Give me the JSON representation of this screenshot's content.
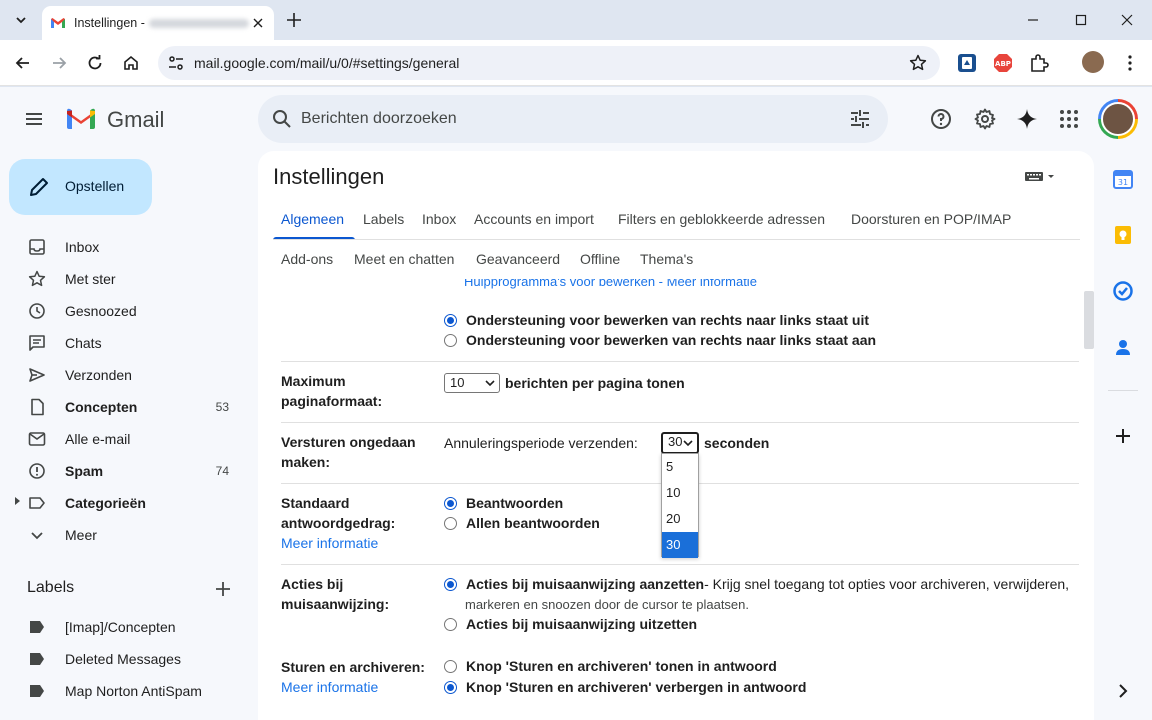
{
  "browser": {
    "tab_title": "Instellingen -",
    "url": "mail.google.com/mail/u/0/#settings/general"
  },
  "gmail": {
    "brand": "Gmail",
    "search_placeholder": "Berichten doorzoeken",
    "compose_label": "Opstellen",
    "nav": [
      {
        "label": "Inbox",
        "icon": "inbox-icon",
        "count": ""
      },
      {
        "label": "Met ster",
        "icon": "star-icon",
        "count": ""
      },
      {
        "label": "Gesnoozed",
        "icon": "clock-icon",
        "count": ""
      },
      {
        "label": "Chats",
        "icon": "chat-icon",
        "count": ""
      },
      {
        "label": "Verzonden",
        "icon": "send-icon",
        "count": ""
      },
      {
        "label": "Concepten",
        "icon": "draft-icon",
        "count": "53"
      },
      {
        "label": "Alle e-mail",
        "icon": "all-mail-icon",
        "count": ""
      },
      {
        "label": "Spam",
        "icon": "spam-icon",
        "count": "74"
      },
      {
        "label": "Categorieën",
        "icon": "label-outline-icon",
        "count": ""
      },
      {
        "label": "Meer",
        "icon": "chevron-down-icon",
        "count": ""
      }
    ],
    "labels_title": "Labels",
    "labels": [
      "[Imap]/Concepten",
      "Deleted Messages",
      "Map Norton AntiSpam"
    ]
  },
  "settings": {
    "title": "Instellingen",
    "tabs_row1": [
      "Algemeen",
      "Labels",
      "Inbox",
      "Accounts en import",
      "Filters en geblokkeerde adressen",
      "Doorsturen en POP/IMAP"
    ],
    "tabs_row2": [
      "Add-ons",
      "Meet en chatten",
      "Geavanceerd",
      "Offline",
      "Thema's"
    ],
    "partial_link": "Hulpprogramma's voor bewerken - Meer informatie",
    "rtl": {
      "off": "Ondersteuning voor bewerken van rechts naar links staat uit",
      "on": "Ondersteuning voor bewerken van rechts naar links staat aan"
    },
    "page_size": {
      "label_line1": "Maximum",
      "label_line2": "paginaformaat:",
      "value": "10",
      "suffix": "berichten per pagina tonen"
    },
    "undo_send": {
      "label_line1": "Versturen ongedaan",
      "label_line2": "maken:",
      "prefix": "Annuleringsperiode verzenden:",
      "value": "30",
      "suffix": "seconden",
      "options": [
        "5",
        "10",
        "20",
        "30"
      ]
    },
    "reply": {
      "label_line1": "Standaard",
      "label_line2": "antwoordgedrag:",
      "link": "Meer informatie",
      "opt1": "Beantwoorden",
      "opt2": "Allen beantwoorden"
    },
    "hover": {
      "label_line1": "Acties bij",
      "label_line2": "muisaanwijzing:",
      "opt1": "Acties bij muisaanwijzing aanzetten",
      "opt1_desc": " - Krijg snel toegang tot opties voor archiveren, verwijderen,",
      "opt1_desc2": "markeren en snoozen door de cursor te plaatsen.",
      "opt2": "Acties bij muisaanwijzing uitzetten"
    },
    "send_archive": {
      "label": "Sturen en archiveren:",
      "link": "Meer informatie",
      "opt1": "Knop 'Sturen en archiveren' tonen in antwoord",
      "opt2": "Knop 'Sturen en archiveren' verbergen in antwoord"
    }
  }
}
